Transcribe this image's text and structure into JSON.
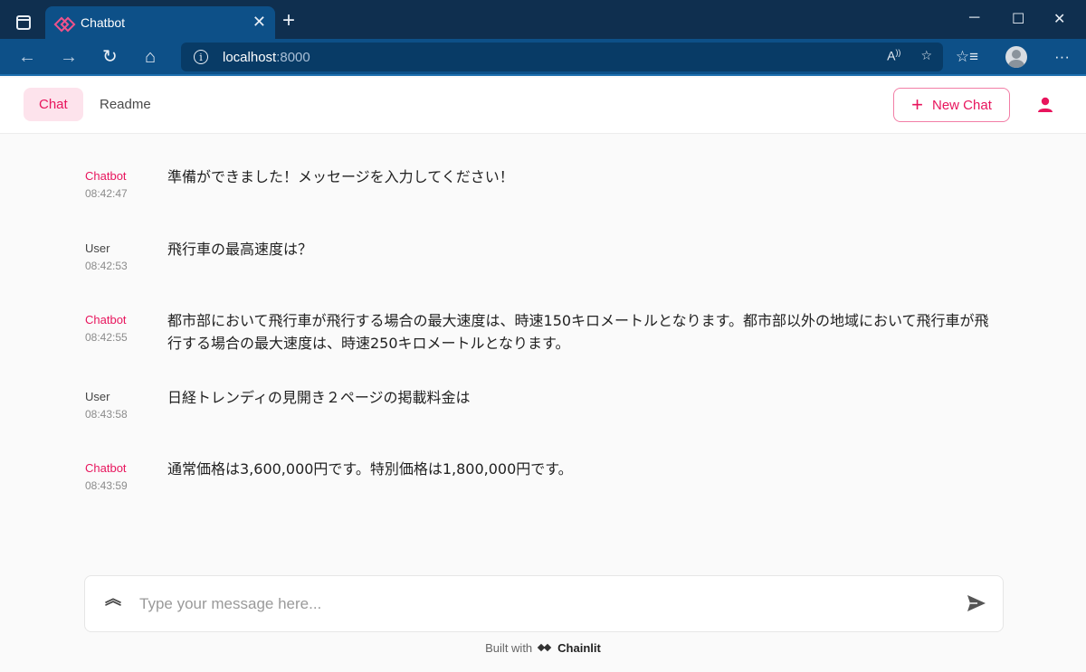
{
  "browser": {
    "tab_title": "Chatbot",
    "url_host": "localhost",
    "url_port": ":8000"
  },
  "app": {
    "tabs": [
      {
        "label": "Chat",
        "active": true
      },
      {
        "label": "Readme",
        "active": false
      }
    ],
    "new_chat_label": "New Chat"
  },
  "messages": [
    {
      "author": "Chatbot",
      "time": "08:42:47",
      "text": "準備ができました！メッセージを入力してください！"
    },
    {
      "author": "User",
      "time": "08:42:53",
      "text": "飛行車の最高速度は？"
    },
    {
      "author": "Chatbot",
      "time": "08:42:55",
      "text": "都市部において飛行車が飛行する場合の最大速度は、時速150キロメートルとなります。都市部以外の地域において飛行車が飛行する場合の最大速度は、時速250キロメートルとなります。"
    },
    {
      "author": "User",
      "time": "08:43:58",
      "text": "日経トレンディの見開き２ページの掲載料金は"
    },
    {
      "author": "Chatbot",
      "time": "08:43:59",
      "text": "通常価格は3,600,000円です。特別価格は1,800,000円です。"
    }
  ],
  "composer": {
    "placeholder": "Type your message here..."
  },
  "footer": {
    "built_with": "Built with",
    "brand": "Chainlit"
  },
  "colors": {
    "accent": "#e8155d",
    "browser_dark": "#0f2f4f",
    "browser_tab": "#0d5088"
  }
}
